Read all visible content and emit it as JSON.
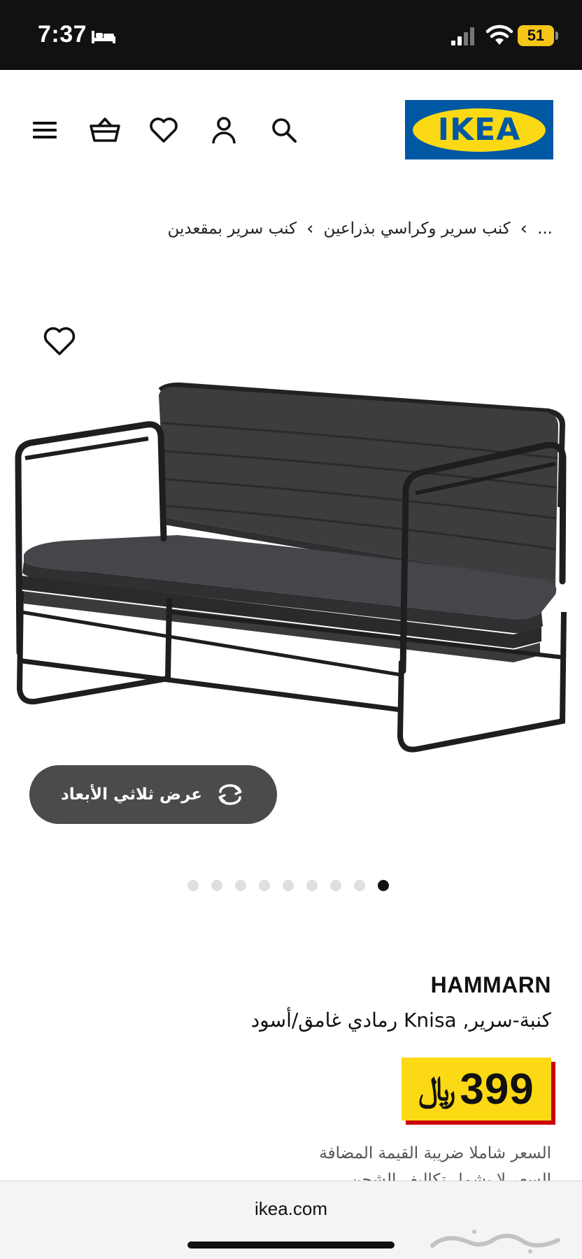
{
  "status_bar": {
    "time": "7:37",
    "battery": "51",
    "bed_icon": "bed-icon",
    "signal_icon": "cellular-signal-icon",
    "wifi_icon": "wifi-icon",
    "battery_color": "#f5c518"
  },
  "header": {
    "logo_text": "IKEA",
    "icons": [
      "menu-icon",
      "basket-icon",
      "heart-icon",
      "user-icon",
      "search-icon"
    ],
    "logo_blue": "#0058a3",
    "logo_yellow": "#fbd914"
  },
  "breadcrumb": {
    "ellipsis": "...",
    "items": [
      "كنب سرير وكراسي بذراعين",
      "كنب سرير بمقعدين"
    ],
    "separator": "›"
  },
  "gallery": {
    "view_3d_label": "عرض ثلاثي الأبعاد",
    "dots_total": 9,
    "active_dot": 9
  },
  "product": {
    "name": "HAMMARN",
    "description": "كنبة-سرير, Knisa رمادي غامق/أسود",
    "price": "399",
    "currency": "﷼",
    "vat_note": "السعر شاملا ضريبة القيمة المضافة",
    "shipping_note": "السعر لا يشمل تكاليف الشحن",
    "price_bg": "#fbd914",
    "price_shadow": "#cc0008"
  },
  "browser": {
    "url": "ikea.com",
    "watermark": "حراج"
  }
}
